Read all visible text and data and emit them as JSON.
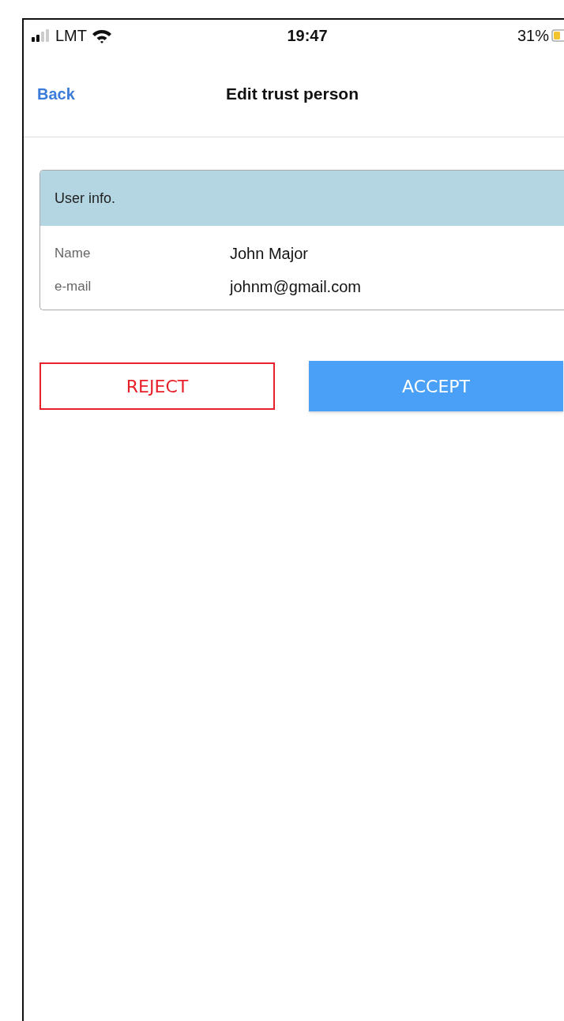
{
  "status_bar": {
    "carrier": "LMT",
    "time": "19:47",
    "battery_percent": "31%"
  },
  "nav": {
    "back": "Back",
    "title": "Edit trust person"
  },
  "card": {
    "title": "User info.",
    "fields": [
      {
        "label": "Name",
        "value": "John Major"
      },
      {
        "label": "e-mail",
        "value": "johnm@gmail.com"
      }
    ]
  },
  "buttons": [
    {
      "label": "REJECT",
      "kind": "outline"
    },
    {
      "label": "ACCEPT",
      "kind": "primary"
    }
  ]
}
